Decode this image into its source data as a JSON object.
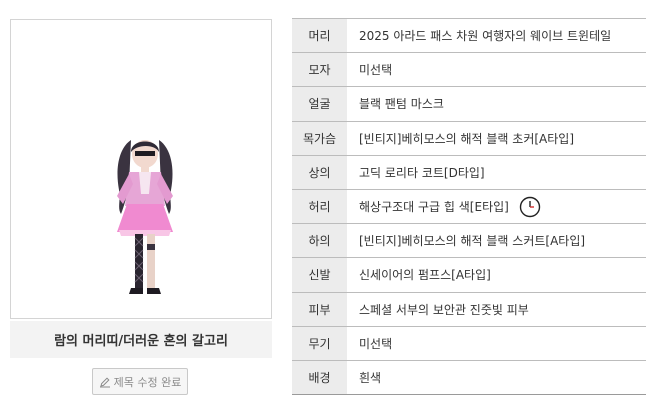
{
  "preview": {
    "title": "람의 머리띠/더러운 혼의 갈고리",
    "edit_button_label": "제목 수정 완료",
    "edit_icon": "pencil-icon"
  },
  "equipment": [
    {
      "slot": "머리",
      "item": "2025 아라드 패스 차원 여행자의 웨이브 트윈테일"
    },
    {
      "slot": "모자",
      "item": "미선택"
    },
    {
      "slot": "얼굴",
      "item": "블랙 팬텀 마스크"
    },
    {
      "slot": "목가슴",
      "item": "[빈티지]베히모스의 해적 블랙 초커[A타입]"
    },
    {
      "slot": "상의",
      "item": "고딕 로리타 코트[D타입]"
    },
    {
      "slot": "허리",
      "item": "해상구조대 구급 힙 색[E타입]",
      "icon": "clock-icon"
    },
    {
      "slot": "하의",
      "item": "[빈티지]베히모스의 해적 블랙 스커트[A타입]"
    },
    {
      "slot": "신발",
      "item": "신세이어의 펌프스[A타입]"
    },
    {
      "slot": "피부",
      "item": "스페셜 서부의 보안관 진줏빛 피부"
    },
    {
      "slot": "무기",
      "item": "미선택"
    },
    {
      "slot": "배경",
      "item": "흰색"
    }
  ]
}
